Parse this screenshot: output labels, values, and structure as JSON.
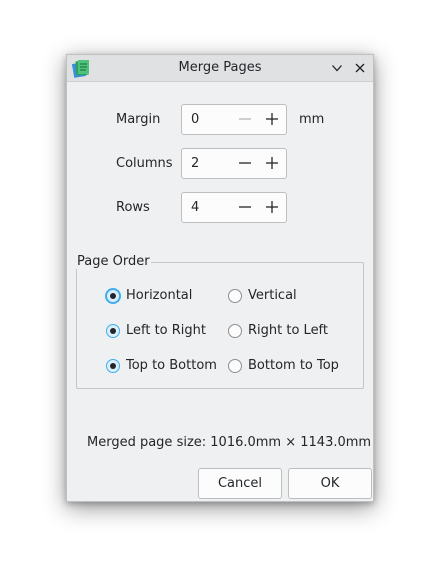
{
  "window": {
    "title": "Merge Pages"
  },
  "fields": {
    "margin": {
      "label": "Margin",
      "value": "0",
      "unit": "mm"
    },
    "columns": {
      "label": "Columns",
      "value": "2"
    },
    "rows": {
      "label": "Rows",
      "value": "4"
    }
  },
  "page_order": {
    "title": "Page Order",
    "options": {
      "horizontal": "Horizontal",
      "vertical": "Vertical",
      "left_to_right": "Left to Right",
      "right_to_left": "Right to Left",
      "top_to_bottom": "Top to Bottom",
      "bottom_to_top": "Bottom to Top"
    },
    "selected": [
      "Horizontal",
      "Left to Right",
      "Top to Bottom"
    ]
  },
  "merged_size": "Merged page size: 1016.0mm × 1143.0mm",
  "buttons": {
    "cancel": "Cancel",
    "ok": "OK"
  },
  "colors": {
    "accent": "#3daee9",
    "dialog_bg": "#eff0f1",
    "titlebar_bg": "#dfe1e3"
  }
}
